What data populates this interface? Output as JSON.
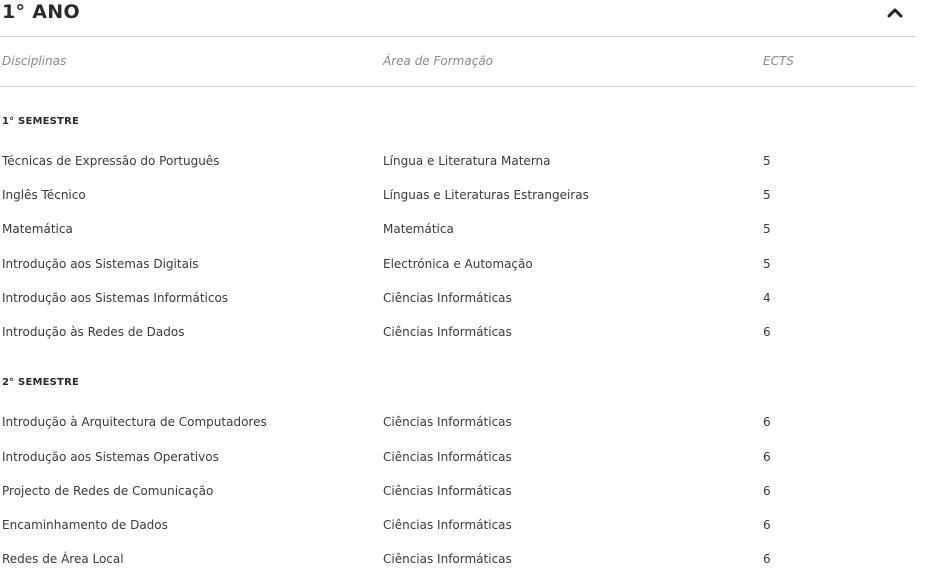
{
  "year": {
    "title": "1° ANO",
    "toggle_icon": "chevron-up-icon"
  },
  "table": {
    "headers": {
      "discipline": "Disciplinas",
      "area": "Área de Formação",
      "ects": "ECTS"
    },
    "semesters": [
      {
        "title": "1° SEMESTRE",
        "rows": [
          {
            "discipline": "Técnicas de Expressão do Português",
            "area": "Língua e Literatura Materna",
            "ects": "5"
          },
          {
            "discipline": "Inglês Técnico",
            "area": "Línguas e Literaturas Estrangeiras",
            "ects": "5"
          },
          {
            "discipline": "Matemática",
            "area": "Matemática",
            "ects": "5"
          },
          {
            "discipline": "Introdução aos Sistemas Digitais",
            "area": "Electrónica e Automação",
            "ects": "5"
          },
          {
            "discipline": "Introdução aos Sistemas Informáticos",
            "area": "Ciências Informáticas",
            "ects": "4"
          },
          {
            "discipline": "Introdução às Redes de Dados",
            "area": "Ciências Informáticas",
            "ects": "6"
          }
        ]
      },
      {
        "title": "2° SEMESTRE",
        "rows": [
          {
            "discipline": "Introdução à Arquitectura de Computadores",
            "area": "Ciências Informáticas",
            "ects": "6"
          },
          {
            "discipline": "Introdução aos Sistemas Operativos",
            "area": "Ciências Informáticas",
            "ects": "6"
          },
          {
            "discipline": "Projecto de Redes de Comunicação",
            "area": "Ciências Informáticas",
            "ects": "6"
          },
          {
            "discipline": "Encaminhamento de Dados",
            "area": "Ciências Informáticas",
            "ects": "6"
          },
          {
            "discipline": "Redes de Área Local",
            "area": "Ciências Informáticas",
            "ects": "6"
          }
        ]
      }
    ]
  }
}
